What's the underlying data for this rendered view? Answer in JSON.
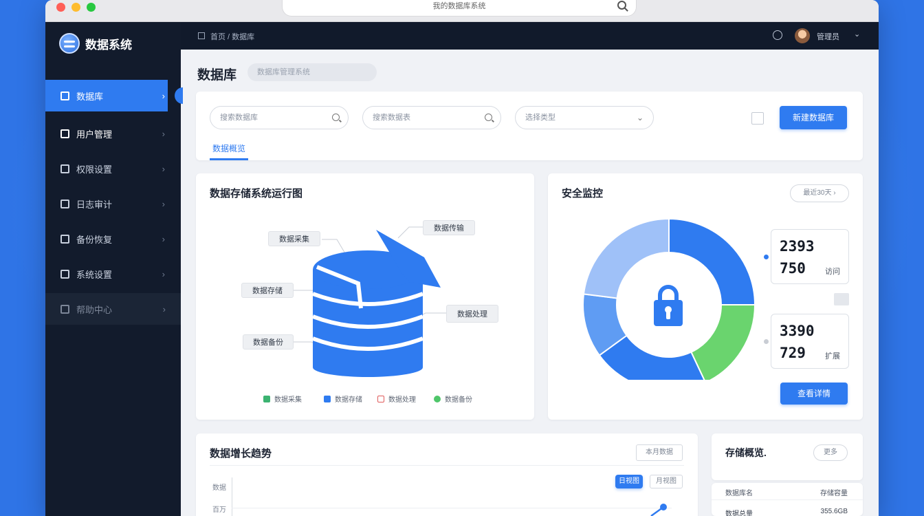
{
  "window": {
    "url_text": "我的数据库系统"
  },
  "app": {
    "brand_name": "数据系统"
  },
  "topbar": {
    "breadcrumb": "首页 / 数据库",
    "user_name": "管理员"
  },
  "sidebar": {
    "items": [
      {
        "label": "数据库"
      },
      {
        "label": "用户管理"
      },
      {
        "label": "权限设置"
      },
      {
        "label": "日志审计"
      },
      {
        "label": "备份恢复"
      },
      {
        "label": "系统设置"
      },
      {
        "label": "帮助中心"
      }
    ]
  },
  "page": {
    "title": "数据库",
    "title_pill": "数据库管理系统"
  },
  "filter": {
    "search1_placeholder": "搜索数据库",
    "search2_placeholder": "搜索数据表",
    "select_placeholder": "选择类型",
    "create_button": "新建数据库",
    "tab": "数据概览"
  },
  "diagram_card": {
    "title": "数据存储系统运行图",
    "callouts": {
      "top_left": "数据采集",
      "top_right": "数据传输",
      "mid_left": "数据存储",
      "mid_right": "数据处理",
      "bottom_left": "数据备份"
    },
    "legend": [
      {
        "label": "数据采集",
        "color": "#3cb371"
      },
      {
        "label": "数据存储",
        "color": "#2f7bf0"
      },
      {
        "label": "数据处理",
        "color": "#e05a5a"
      },
      {
        "label": "数据备份",
        "color": "#4fc66a"
      }
    ]
  },
  "security_card": {
    "title": "安全监控",
    "period_button": "最近30天",
    "stats": [
      {
        "value_top": "2393",
        "value_bottom": "750",
        "unit": "访问"
      },
      {
        "value_top": "3390",
        "value_bottom": "729",
        "unit": "扩展"
      }
    ],
    "detail_button": "查看详情",
    "donut": [
      {
        "name": "segment-a",
        "value": 25,
        "color": "#2f7bf0"
      },
      {
        "name": "segment-b",
        "value": 18,
        "color": "#6ad46e"
      },
      {
        "name": "segment-c",
        "value": 22,
        "color": "#2f7bf0"
      },
      {
        "name": "segment-d",
        "value": 12,
        "color": "#5f9cf3"
      },
      {
        "name": "segment-e",
        "value": 23,
        "color": "#9fc1f8"
      }
    ]
  },
  "trend_card": {
    "title": "数据增长趋势",
    "range_button": "本月数据",
    "toggle_active": "日视图",
    "toggle_inactive": "月视图",
    "y_labels": [
      "数据",
      "百万"
    ]
  },
  "small_card": {
    "title": "存储概览.",
    "more_button": "更多",
    "col_left": "数据库名",
    "col_right": "存储容量",
    "row_left": "数据总量",
    "row_right": "355.6GB"
  }
}
